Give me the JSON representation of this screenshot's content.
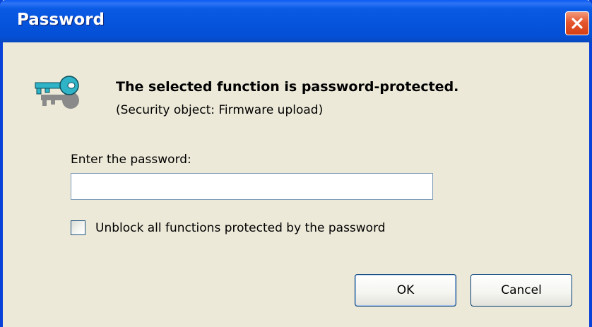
{
  "window": {
    "title": "Password",
    "close_icon": "close-icon"
  },
  "message": {
    "icon": "key-icon",
    "main": "The selected function is password-protected.",
    "sub": "(Security object: Firmware upload)"
  },
  "form": {
    "password_label": "Enter the password:",
    "password_value": "",
    "unblock_label": "Unblock all functions protected by the password",
    "unblock_checked": false
  },
  "buttons": {
    "ok_label": "OK",
    "cancel_label": "Cancel"
  },
  "colors": {
    "titlebar": "#0654dc",
    "dialog_bg": "#ece9d8",
    "close_button": "#e4572f",
    "key_icon": "#2fb3c7"
  }
}
